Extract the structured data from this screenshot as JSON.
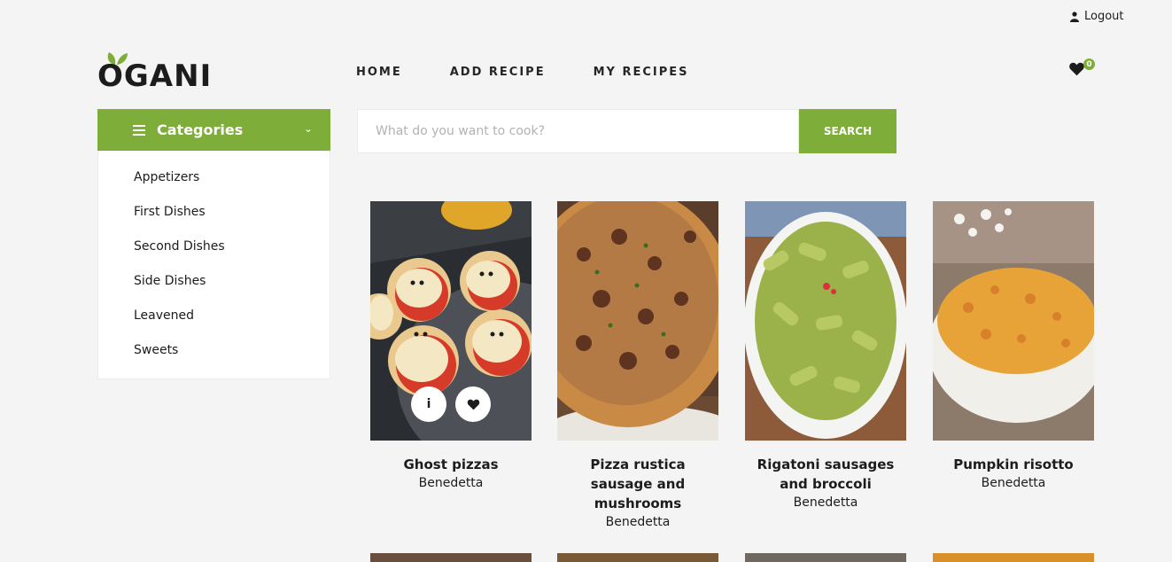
{
  "header": {
    "logout_label": "Logout",
    "logo_text": "OGANI",
    "nav": [
      "HOME",
      "ADD RECIPE",
      "MY RECIPES"
    ],
    "favorites_count": "0"
  },
  "categories": {
    "title": "Categories",
    "items": [
      "Appetizers",
      "First Dishes",
      "Second Dishes",
      "Side Dishes",
      "Leavened",
      "Sweets"
    ]
  },
  "search": {
    "placeholder": "What do you want to cook?",
    "button_label": "SEARCH"
  },
  "recipes": [
    {
      "name": "Ghost pizzas",
      "author": "Benedetta"
    },
    {
      "name": "Pizza rustica sausage and mushrooms",
      "author": "Benedetta"
    },
    {
      "name": "Rigatoni sausages and broccoli",
      "author": "Benedetta"
    },
    {
      "name": "Pumpkin risotto",
      "author": "Benedetta"
    }
  ],
  "colors": {
    "accent": "#7fad39",
    "text": "#1c1c1c",
    "background": "#f4f4f4"
  }
}
